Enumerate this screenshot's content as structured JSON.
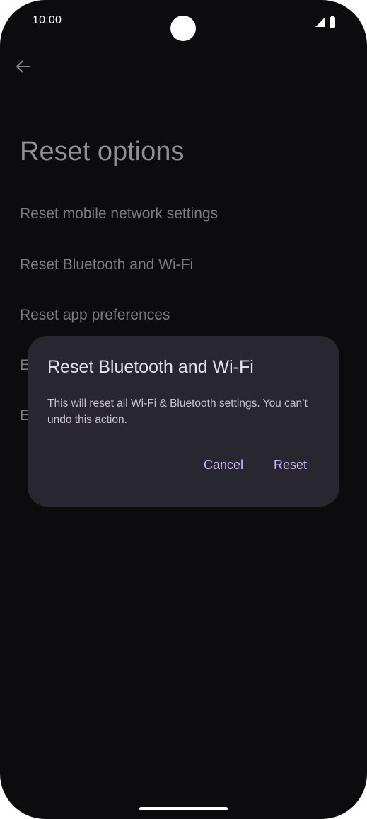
{
  "status_bar": {
    "time": "10:00",
    "icons": [
      "signal-icon",
      "battery-icon"
    ]
  },
  "header": {
    "back_icon": "arrow-back-icon",
    "title": "Reset options"
  },
  "options": [
    {
      "label": "Reset mobile network settings"
    },
    {
      "label": "Reset Bluetooth and Wi-Fi"
    },
    {
      "label": "Reset app preferences"
    },
    {
      "label": "E"
    },
    {
      "label": "E"
    }
  ],
  "dialog": {
    "title": "Reset Bluetooth and Wi-Fi",
    "body": "This will reset all Wi-Fi & Bluetooth settings. You can’t undo this action.",
    "cancel_label": "Cancel",
    "confirm_label": "Reset"
  },
  "colors": {
    "background": "#0c0c0f",
    "dialog": "#28262f",
    "accent": "#cfbdfe"
  }
}
